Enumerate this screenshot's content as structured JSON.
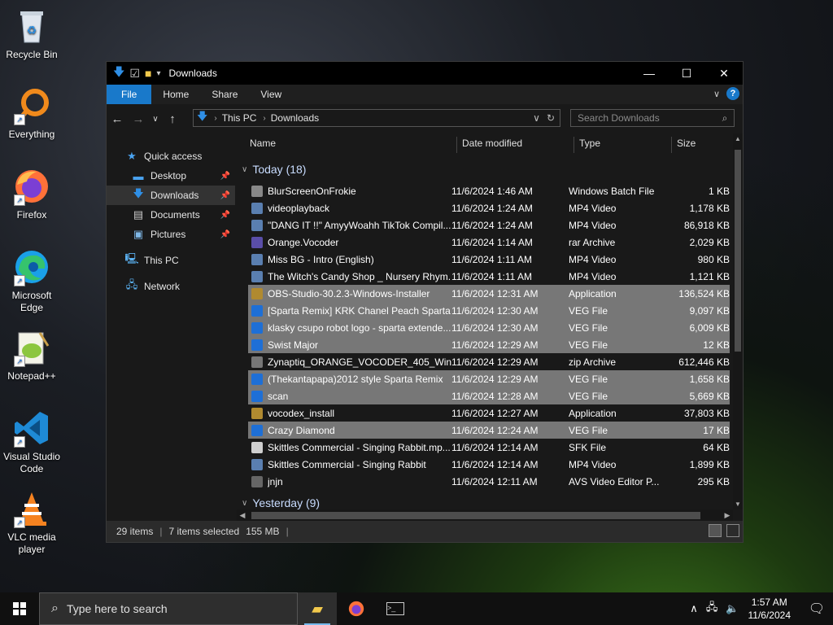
{
  "desktop": {
    "icons": [
      {
        "label": "Recycle Bin"
      },
      {
        "label": "Everything"
      },
      {
        "label": "Firefox"
      },
      {
        "label": "Microsoft Edge"
      },
      {
        "label": "Notepad++"
      },
      {
        "label": "Visual Studio Code"
      },
      {
        "label": "VLC media player"
      }
    ]
  },
  "window": {
    "title": "Downloads",
    "ribbon_tabs": [
      "File",
      "Home",
      "Share",
      "View"
    ],
    "help_label": "?",
    "address": {
      "root": "This PC",
      "current": "Downloads"
    },
    "search_placeholder": "Search Downloads",
    "nav": {
      "quick_access": "Quick access",
      "items": [
        "Desktop",
        "Downloads",
        "Documents",
        "Pictures"
      ],
      "this_pc": "This PC",
      "network": "Network"
    },
    "columns": {
      "name": "Name",
      "date": "Date modified",
      "type": "Type",
      "size": "Size"
    },
    "groups": {
      "today": "Today (18)",
      "yesterday": "Yesterday (9)"
    },
    "files": [
      {
        "name": "BlurScreenOnFrokie",
        "date": "11/6/2024 1:46 AM",
        "type": "Windows Batch File",
        "size": "1 KB"
      },
      {
        "name": "videoplayback",
        "date": "11/6/2024 1:24 AM",
        "type": "MP4 Video",
        "size": "1,178 KB"
      },
      {
        "name": "\"DANG IT !!\" AmyyWoahh TikTok Compil...",
        "date": "11/6/2024 1:24 AM",
        "type": "MP4 Video",
        "size": "86,918 KB"
      },
      {
        "name": "Orange.Vocoder",
        "date": "11/6/2024 1:14 AM",
        "type": "rar Archive",
        "size": "2,029 KB"
      },
      {
        "name": "Miss BG - Intro (English)",
        "date": "11/6/2024 1:11 AM",
        "type": "MP4 Video",
        "size": "980 KB"
      },
      {
        "name": "The Witch's Candy Shop _ Nursery Rhym...",
        "date": "11/6/2024 1:11 AM",
        "type": "MP4 Video",
        "size": "1,121 KB"
      },
      {
        "name": "OBS-Studio-30.2.3-Windows-Installer",
        "date": "11/6/2024 12:31 AM",
        "type": "Application",
        "size": "136,524 KB"
      },
      {
        "name": "[Sparta Remix] KRK Chanel Peach Sparta ...",
        "date": "11/6/2024 12:30 AM",
        "type": "VEG File",
        "size": "9,097 KB"
      },
      {
        "name": "klasky csupo robot logo - sparta extende...",
        "date": "11/6/2024 12:30 AM",
        "type": "VEG File",
        "size": "6,009 KB"
      },
      {
        "name": "Swist Major",
        "date": "11/6/2024 12:29 AM",
        "type": "VEG File",
        "size": "12 KB"
      },
      {
        "name": "Zynaptiq_ORANGE_VOCODER_405_Win",
        "date": "11/6/2024 12:29 AM",
        "type": "zip Archive",
        "size": "612,446 KB"
      },
      {
        "name": "(Thekantapapa)2012 style Sparta Remix",
        "date": "11/6/2024 12:29 AM",
        "type": "VEG File",
        "size": "1,658 KB"
      },
      {
        "name": "scan",
        "date": "11/6/2024 12:28 AM",
        "type": "VEG File",
        "size": "5,669 KB"
      },
      {
        "name": "vocodex_install",
        "date": "11/6/2024 12:27 AM",
        "type": "Application",
        "size": "37,803 KB"
      },
      {
        "name": "Crazy Diamond",
        "date": "11/6/2024 12:24 AM",
        "type": "VEG File",
        "size": "17 KB"
      },
      {
        "name": "Skittles Commercial - Singing Rabbit.mp...",
        "date": "11/6/2024 12:14 AM",
        "type": "SFK File",
        "size": "64 KB"
      },
      {
        "name": "Skittles Commercial - Singing Rabbit",
        "date": "11/6/2024 12:14 AM",
        "type": "MP4 Video",
        "size": "1,899 KB"
      },
      {
        "name": "jnjn",
        "date": "11/6/2024 12:11 AM",
        "type": "AVS Video Editor P...",
        "size": "295 KB"
      }
    ],
    "status": {
      "items": "29 items",
      "selected": "7 items selected",
      "size": "155 MB"
    }
  },
  "taskbar": {
    "search_placeholder": "Type here to search",
    "time": "1:57 AM",
    "date": "11/6/2024"
  },
  "colors": {
    "accent": "#1979ca",
    "selection": "#777777",
    "window_bg": "#191919"
  }
}
